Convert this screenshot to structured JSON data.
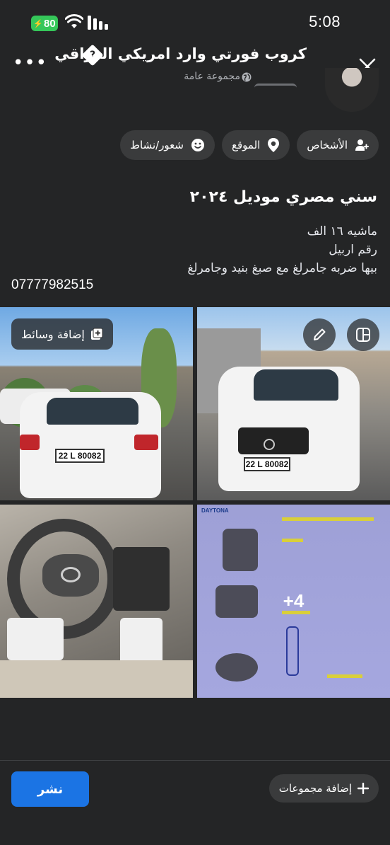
{
  "status_bar": {
    "battery": "80",
    "time": "5:08"
  },
  "header": {
    "title": "كروب فورتي وارد امريكي العراقي",
    "title_badge": "?",
    "subtitle": "مجموعة عامة"
  },
  "chips": [
    {
      "label": "الأشخاص",
      "icon": "people-icon"
    },
    {
      "label": "الموقع",
      "icon": "location-pin-icon"
    },
    {
      "label": "شعور/نشاط",
      "icon": "smiley-icon"
    }
  ],
  "post": {
    "title": "سني مصري موديل ٢٠٢٤",
    "lines": [
      "ماشيه ١٦ الف",
      "رقم اربيل",
      "بيها ضربه جامرلغ مع صبغ بنيد وجامرلغ"
    ],
    "phone": "07777982515"
  },
  "media": {
    "add_media_label": "إضافة وسائط",
    "more_count": "+4",
    "plate_rear": "22 L 80082",
    "plate_front": "22 L 80082",
    "doc_brand": "DAYTONA"
  },
  "footer": {
    "post_button": "نشر",
    "add_groups_button": "إضافة مجموعات"
  },
  "colors": {
    "background": "#242526",
    "chip": "#3a3b3c",
    "primary": "#1b74e4",
    "battery": "#35c759"
  }
}
